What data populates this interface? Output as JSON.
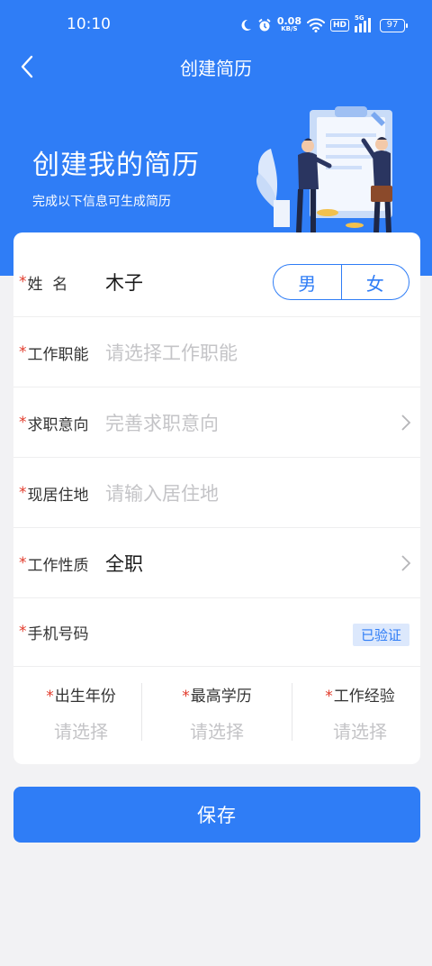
{
  "status_bar": {
    "time": "10:10",
    "net_speed": "0.08",
    "net_unit": "KB/S",
    "hd": "HD",
    "signal": "5G",
    "battery": "97"
  },
  "nav": {
    "title": "创建简历"
  },
  "hero": {
    "title": "创建我的简历",
    "subtitle": "完成以下信息可生成简历"
  },
  "form": {
    "name": {
      "label": "姓  名",
      "value": "木子",
      "gender_options": [
        "男",
        "女"
      ]
    },
    "job_function": {
      "label": "工作职能",
      "placeholder": "请选择工作职能"
    },
    "job_intention": {
      "label": "求职意向",
      "placeholder": "完善求职意向"
    },
    "residence": {
      "label": "现居住地",
      "placeholder": "请输入居住地"
    },
    "job_type": {
      "label": "工作性质",
      "value": "全职"
    },
    "phone": {
      "label": "手机号码",
      "value": "",
      "badge": "已验证"
    },
    "birth_year": {
      "label": "出生年份",
      "placeholder": "请选择"
    },
    "education": {
      "label": "最高学历",
      "placeholder": "请选择"
    },
    "experience": {
      "label": "工作经验",
      "placeholder": "请选择"
    }
  },
  "save_label": "保存",
  "colors": {
    "primary": "#2f7df6",
    "required": "#e23b2b",
    "placeholder": "#c4c4c7",
    "background": "#f2f2f4"
  },
  "icons": [
    "back-arrow-icon",
    "chevron-right-icon",
    "moon-icon",
    "alarm-icon",
    "wifi-icon",
    "signal-icon",
    "battery-icon"
  ]
}
